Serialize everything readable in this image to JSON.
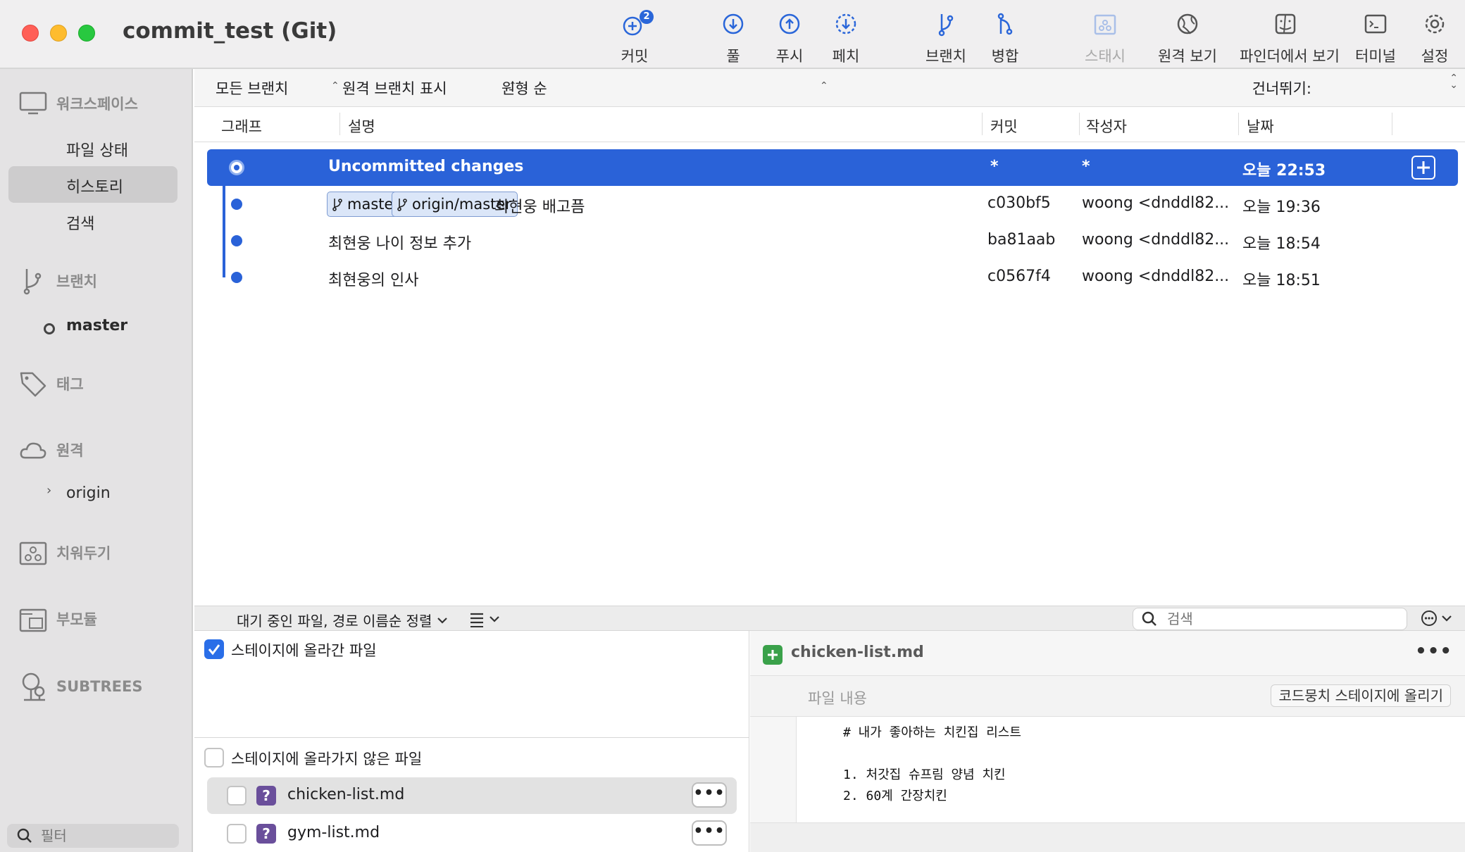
{
  "window": {
    "title": "commit_test (Git)"
  },
  "toolbar": {
    "items": [
      {
        "label": "커밋",
        "icon": "commit-icon",
        "badge": "2"
      },
      {
        "label": "풀",
        "icon": "pull-icon"
      },
      {
        "label": "푸시",
        "icon": "push-icon"
      },
      {
        "label": "페치",
        "icon": "fetch-icon"
      },
      {
        "label": "브랜치",
        "icon": "branch-icon"
      },
      {
        "label": "병합",
        "icon": "merge-icon"
      },
      {
        "label": "스태시",
        "icon": "stash-icon",
        "disabled": true
      },
      {
        "label": "원격 보기",
        "icon": "globe-icon"
      },
      {
        "label": "파인더에서 보기",
        "icon": "finder-icon"
      },
      {
        "label": "터미널",
        "icon": "terminal-icon"
      },
      {
        "label": "설정",
        "icon": "gear-icon"
      }
    ]
  },
  "sidebar": {
    "workspace": {
      "label": "워크스페이스",
      "items": [
        "파일 상태",
        "히스토리",
        "검색"
      ],
      "selected": "히스토리"
    },
    "branches": {
      "label": "브랜치",
      "items": [
        "master"
      ]
    },
    "tags": {
      "label": "태그"
    },
    "remotes": {
      "label": "원격",
      "items": [
        "origin"
      ]
    },
    "stashes": {
      "label": "치워두기"
    },
    "submodules": {
      "label": "부모듈"
    },
    "subtrees": {
      "label": "SUBTREES"
    },
    "filter_placeholder": "필터"
  },
  "filter_bar": {
    "branch_filter": "모든 브랜치",
    "remote_filter": "원격 브랜치 표시",
    "order": "원형 순",
    "jump_label": "건너뛰기:"
  },
  "columns": [
    "그래프",
    "설명",
    "커밋",
    "작성자",
    "날짜"
  ],
  "commits": [
    {
      "description": "Uncommitted changes",
      "hash": "*",
      "author": "*",
      "date": "오늘 22:53",
      "selected": true
    },
    {
      "tags": [
        "master",
        "origin/master"
      ],
      "description": "최현웅 배고픔",
      "hash": "c030bf5",
      "author": "woong <dnddl82...",
      "date": "오늘 19:36"
    },
    {
      "description": "최현웅 나이 정보 추가",
      "hash": "ba81aab",
      "author": "woong <dnddl82...",
      "date": "오늘 18:54"
    },
    {
      "description": "최현웅의 인사",
      "hash": "c0567f4",
      "author": "woong <dnddl82...",
      "date": "오늘 18:51"
    }
  ],
  "bottom_bar": {
    "sort_label": "대기 중인 파일, 경로 이름순 정렬",
    "search_placeholder": "검색"
  },
  "staged": {
    "title": "스테이지에 올라간 파일",
    "checked": true
  },
  "unstaged": {
    "title": "스테이지에 올라가지 않은 파일",
    "files": [
      {
        "name": "chicken-list.md",
        "status_icon": "?",
        "selected": true
      },
      {
        "name": "gym-list.md",
        "status_icon": "?"
      }
    ],
    "more_label": "•••"
  },
  "diff": {
    "file_name": "chicken-list.md",
    "more_label": "•••",
    "hunk_label": "파일 내용",
    "stage_hunk_button": "코드뭉치 스테이지에 올리기",
    "lines": [
      "# 내가 좋아하는 치킨집 리스트",
      "",
      "1. 처갓집 슈프림 양념 치킨",
      "2. 60계 간장치킨"
    ]
  },
  "colors": {
    "selection": "#2a62d8",
    "tag_bg": "#dbe6f8",
    "untracked": "#6a4f9b",
    "added": "#3aa14a"
  }
}
